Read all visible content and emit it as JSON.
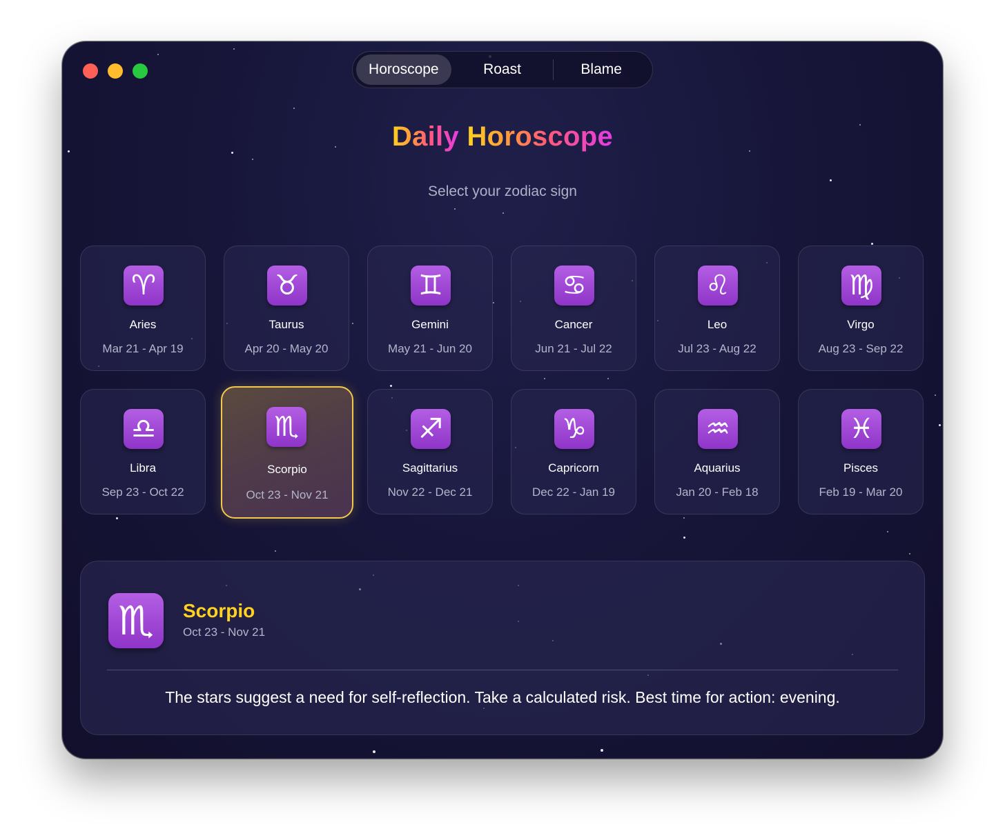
{
  "nav": {
    "tabs": [
      {
        "label": "Horoscope",
        "active": true
      },
      {
        "label": "Roast",
        "active": false
      },
      {
        "label": "Blame",
        "active": false
      }
    ]
  },
  "header": {
    "title_part1": "Daily",
    "title_part2": "Horoscope",
    "subtitle": "Select your zodiac sign"
  },
  "signs": [
    {
      "name": "Aries",
      "range": "Mar 21 - Apr 19",
      "glyph": "♈"
    },
    {
      "name": "Taurus",
      "range": "Apr 20 - May 20",
      "glyph": "♉"
    },
    {
      "name": "Gemini",
      "range": "May 21 - Jun 20",
      "glyph": "♊"
    },
    {
      "name": "Cancer",
      "range": "Jun 21 - Jul 22",
      "glyph": "♋"
    },
    {
      "name": "Leo",
      "range": "Jul 23 - Aug 22",
      "glyph": "♌"
    },
    {
      "name": "Virgo",
      "range": "Aug 23 - Sep 22",
      "glyph": "♍"
    },
    {
      "name": "Libra",
      "range": "Sep 23 - Oct 22",
      "glyph": "♎"
    },
    {
      "name": "Scorpio",
      "range": "Oct 23 - Nov 21",
      "glyph": "♏"
    },
    {
      "name": "Sagittarius",
      "range": "Nov 22 - Dec 21",
      "glyph": "♐"
    },
    {
      "name": "Capricorn",
      "range": "Dec 22 - Jan 19",
      "glyph": "♑"
    },
    {
      "name": "Aquarius",
      "range": "Jan 20 - Feb 18",
      "glyph": "♒"
    },
    {
      "name": "Pisces",
      "range": "Feb 19 - Mar 20",
      "glyph": "♓"
    }
  ],
  "selected_index": 7,
  "detail": {
    "glyph": "♏",
    "name": "Scorpio",
    "range": "Oct 23 - Nov 21",
    "text": "The stars suggest a need for self-reflection. Take a calculated risk. Best time for action: evening."
  },
  "colors": {
    "accent_gold": "#ffd21f",
    "selected_border": "#f4c84a",
    "badge_purple": "#9c44d4"
  }
}
